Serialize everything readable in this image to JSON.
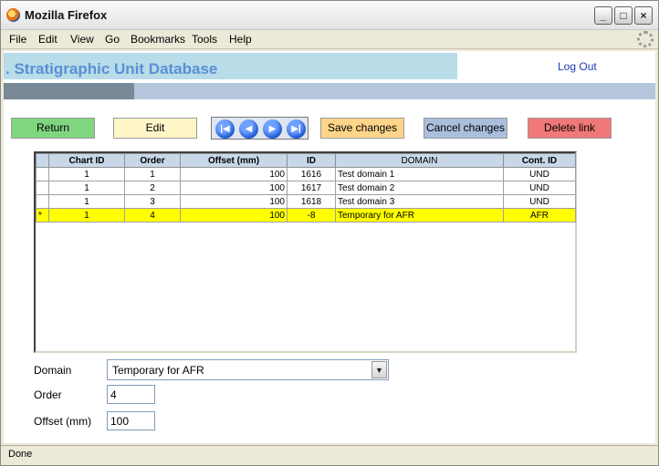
{
  "window": {
    "title": "Mozilla Firefox",
    "min_glyph": "_",
    "max_glyph": "□",
    "close_glyph": "×"
  },
  "menu": [
    "File",
    "Edit",
    "View",
    "Go",
    "Bookmarks",
    "Tools",
    "Help"
  ],
  "header": {
    "title": ". Stratigraphic Unit Database",
    "logout": "Log Out"
  },
  "progress": {
    "fraction": 0.2
  },
  "toolbar": {
    "return_label": "Return",
    "edit_label": "Edit",
    "save_label": "Save changes",
    "cancel_label": "Cancel changes",
    "delete_label": "Delete link",
    "nav": {
      "first": "|◀",
      "prev": "◀",
      "next": "▶",
      "last": "▶|"
    }
  },
  "grid": {
    "columns": [
      "",
      "Chart ID",
      "Order",
      "Offset (mm)",
      "ID",
      "DOMAIN",
      "Cont. ID"
    ],
    "rows": [
      {
        "marker": "",
        "chart_id": "1",
        "order": "1",
        "offset": "100",
        "id": "1616",
        "domain": "Test domain 1",
        "cont_id": "UND",
        "selected": false
      },
      {
        "marker": "",
        "chart_id": "1",
        "order": "2",
        "offset": "100",
        "id": "1617",
        "domain": "Test domain 2",
        "cont_id": "UND",
        "selected": false
      },
      {
        "marker": "",
        "chart_id": "1",
        "order": "3",
        "offset": "100",
        "id": "1618",
        "domain": "Test domain 3",
        "cont_id": "UND",
        "selected": false
      },
      {
        "marker": "*",
        "chart_id": "1",
        "order": "4",
        "offset": "100",
        "id": "-8",
        "domain": "Temporary for AFR",
        "cont_id": "AFR",
        "selected": true
      }
    ]
  },
  "form": {
    "domain_label": "Domain",
    "domain_value": "Temporary for AFR",
    "order_label": "Order",
    "order_value": "4",
    "offset_label": "Offset (mm)",
    "offset_value": "100"
  },
  "status": {
    "text": "Done"
  },
  "colors": {
    "accent_title": "#5b8fd6",
    "return": "#7fd67f",
    "edit": "#fff6c8",
    "save": "#ffd58a",
    "cancel": "#a9bfdc",
    "delete": "#f07878",
    "selected_row": "#ffff00"
  }
}
